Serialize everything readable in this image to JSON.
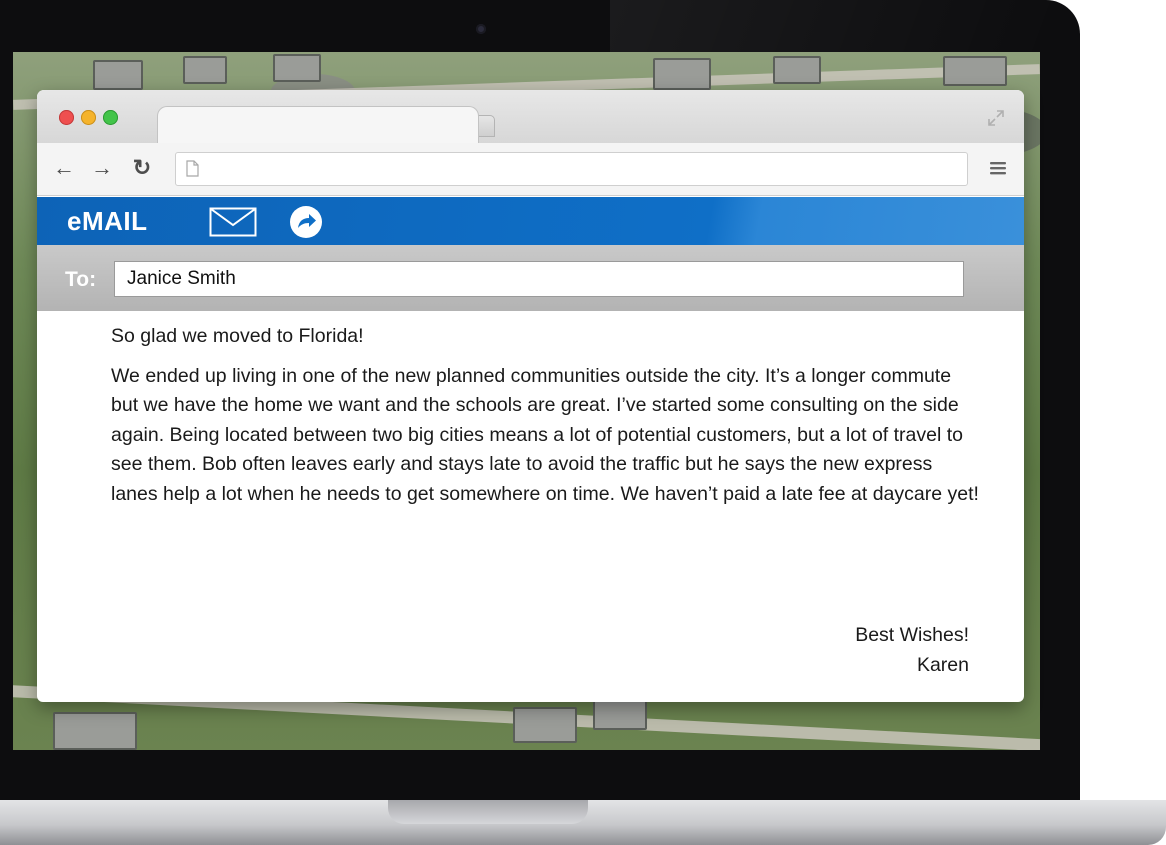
{
  "browser": {
    "address_value": "",
    "nav": {
      "back_glyph": "←",
      "forward_glyph": "→",
      "reload_glyph": "↻"
    }
  },
  "app": {
    "title": "eMAIL",
    "icons": [
      "envelope-icon",
      "forward-icon"
    ],
    "accent_color": "#0f6fc7"
  },
  "compose": {
    "to_label": "To:",
    "to_value": "Janice Smith",
    "greeting": "So glad we moved to Florida!",
    "paragraph": "We ended up living in one of the new planned communities outside the city.  It’s a longer commute but we have the home we want and the schools are great. I’ve started some consulting on the side again. Being located between two big cities means a lot of potential customers, but a lot of travel to see them. Bob often leaves early and stays late to avoid the traffic but he says the new express lanes help a lot when he needs to get somewhere on time. We haven’t paid a late fee at daycare yet!",
    "closing": "Best Wishes!",
    "signature": "Karen"
  }
}
